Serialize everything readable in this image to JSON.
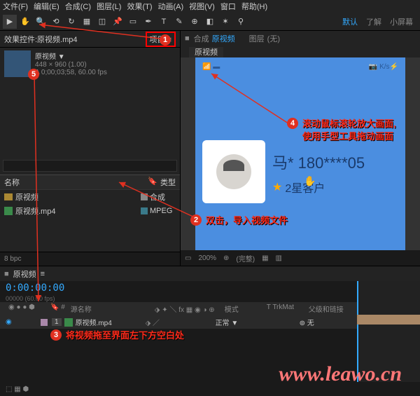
{
  "menu": {
    "file": "文件(F)",
    "edit": "编辑(E)",
    "comp": "合成(C)",
    "layer": "图层(L)",
    "effect": "效果(T)",
    "anim": "动画(A)",
    "view": "视图(V)",
    "window": "窗口",
    "help": "帮助(H)"
  },
  "workspace": {
    "default": "默认",
    "learn": "了解",
    "small": "小屏幕"
  },
  "project": {
    "panel_label": "效果控件:原视频.mp4",
    "project_tab": "项目 ≡",
    "item_name": "原视频 ▼",
    "dims": "448 × 960 (1.00)",
    "dur": "Δ 0;00;03;58, 60.00 fps",
    "col_name": "名称",
    "col_type": "类型",
    "rows": [
      {
        "name": "原视频",
        "type": "合成"
      },
      {
        "name": "原视频.mp4",
        "type": "MPEG"
      }
    ],
    "footer": "8 bpc"
  },
  "viewer": {
    "comp_label": "合成",
    "comp_name": "原视频",
    "layer_label": "图层",
    "layer_name": "(无)",
    "tab": "原视频",
    "phone": "马* 180****05",
    "stars": "2星客户",
    "footer": {
      "zoom": "200%",
      "res": "(完整)"
    }
  },
  "timeline": {
    "tab": "原视频",
    "tc": "0:00:00:00",
    "sub": "00000 (60.00 fps)",
    "col_src": "源名称",
    "col_mode": "模式",
    "col_trk": "T  TrkMat",
    "col_parent": "父级和链接",
    "layer_name": "原视频.mp4",
    "layer_mode": "正常 ▼",
    "layer_parent": "无"
  },
  "annotations": {
    "a2": "双击，导入视频文件",
    "a3": "将视频拖至界面左下方空白处",
    "a4a": "滚动鼠标滚轮放大画面,",
    "a4b": "使用手型工具拖动画面"
  },
  "watermark": "www.leawo.cn"
}
